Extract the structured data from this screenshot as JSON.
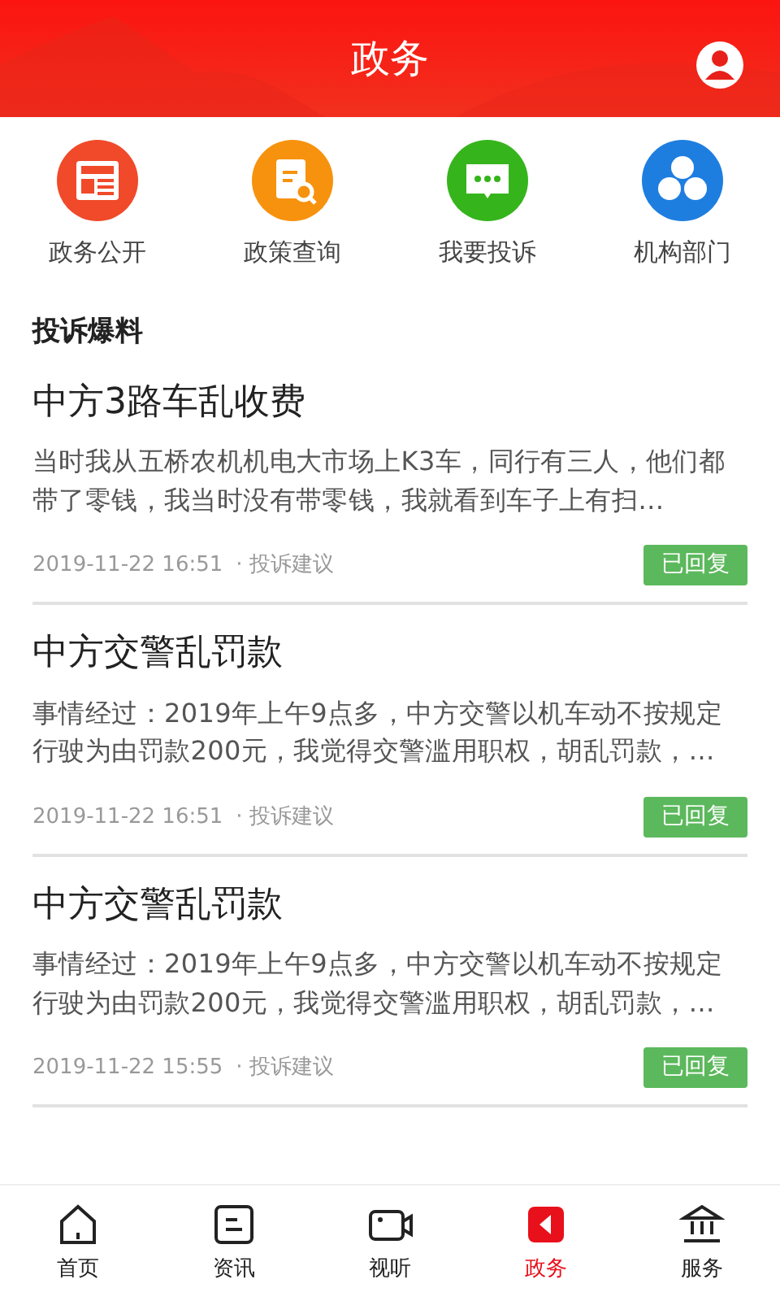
{
  "header": {
    "title": "政务"
  },
  "shortcuts": [
    {
      "kind": "news",
      "label": "政务公开"
    },
    {
      "kind": "policy",
      "label": "政策查询"
    },
    {
      "kind": "complaint",
      "label": "我要投诉"
    },
    {
      "kind": "departments",
      "label": "机构部门"
    }
  ],
  "section": {
    "title": "投诉爆料"
  },
  "posts": [
    {
      "title": "中方3路车乱收费",
      "summary": "当时我从五桥农机机电大市场上K3车，同行有三人，他们都带了零钱，我当时没有带零钱，我就看到车子上有扫…",
      "time": "2019-11-22 16:51",
      "category": "· 投诉建议",
      "status": "已回复"
    },
    {
      "title": "中方交警乱罚款",
      "summary": "事情经过：2019年上午9点多，中方交警以机车动不按规定行驶为由罚款200元，我觉得交警滥用职权，胡乱罚款，…",
      "time": "2019-11-22 16:51",
      "category": "· 投诉建议",
      "status": "已回复"
    },
    {
      "title": "中方交警乱罚款",
      "summary": "事情经过：2019年上午9点多，中方交警以机车动不按规定行驶为由罚款200元，我觉得交警滥用职权，胡乱罚款，…",
      "time": "2019-11-22 15:55",
      "category": "· 投诉建议",
      "status": "已回复"
    }
  ],
  "tabs": [
    {
      "kind": "home",
      "label": "首页",
      "selected": false
    },
    {
      "kind": "news",
      "label": "资讯",
      "selected": false
    },
    {
      "kind": "video",
      "label": "视听",
      "selected": false
    },
    {
      "kind": "gov",
      "label": "政务",
      "selected": true
    },
    {
      "kind": "service",
      "label": "服务",
      "selected": false
    }
  ]
}
